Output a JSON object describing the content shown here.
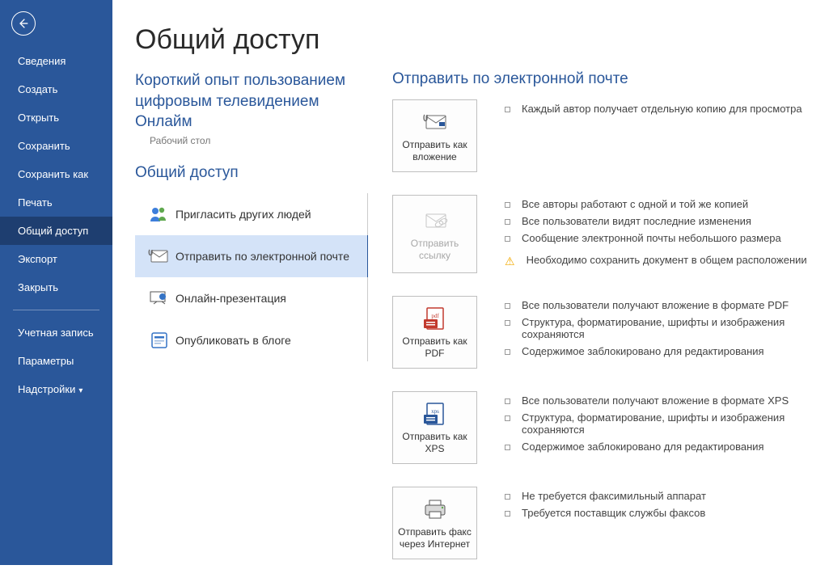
{
  "sidebar": {
    "items": [
      {
        "label": "Сведения"
      },
      {
        "label": "Создать"
      },
      {
        "label": "Открыть"
      },
      {
        "label": "Сохранить"
      },
      {
        "label": "Сохранить как"
      },
      {
        "label": "Печать"
      },
      {
        "label": "Общий доступ"
      },
      {
        "label": "Экспорт"
      },
      {
        "label": "Закрыть"
      }
    ],
    "footer": [
      {
        "label": "Учетная запись"
      },
      {
        "label": "Параметры"
      },
      {
        "label": "Надстройки"
      }
    ]
  },
  "main": {
    "title": "Общий доступ",
    "doc_title": "Короткий опыт пользованием цифровым телевидением Онлайм",
    "doc_location": "Рабочий стол",
    "share_heading": "Общий доступ",
    "share_options": [
      {
        "label": "Пригласить других людей"
      },
      {
        "label": "Отправить по электронной почте"
      },
      {
        "label": "Онлайн-презентация"
      },
      {
        "label": "Опубликовать в блоге"
      }
    ],
    "email_heading": "Отправить по электронной почте",
    "send_blocks": [
      {
        "btn": "Отправить как вложение",
        "details": [
          "Каждый автор получает отдельную копию для просмотра"
        ]
      },
      {
        "btn": "Отправить ссылку",
        "disabled": true,
        "details": [
          "Все авторы работают с одной и той же копией",
          "Все пользователи видят последние изменения",
          "Сообщение электронной почты небольшого размера"
        ],
        "warning": "Необходимо сохранить документ в общем расположении"
      },
      {
        "btn": "Отправить как PDF",
        "details": [
          "Все пользователи получают вложение в формате PDF",
          "Структура, форматирование, шрифты и изображения сохраняются",
          "Содержимое заблокировано для редактирования"
        ]
      },
      {
        "btn": "Отправить как XPS",
        "details": [
          "Все пользователи получают вложение в формате XPS",
          "Структура, форматирование, шрифты и изображения сохраняются",
          "Содержимое заблокировано для редактирования"
        ]
      },
      {
        "btn": "Отправить факс через Интернет",
        "details": [
          "Не требуется факсимильный аппарат",
          "Требуется поставщик службы факсов"
        ]
      }
    ]
  }
}
